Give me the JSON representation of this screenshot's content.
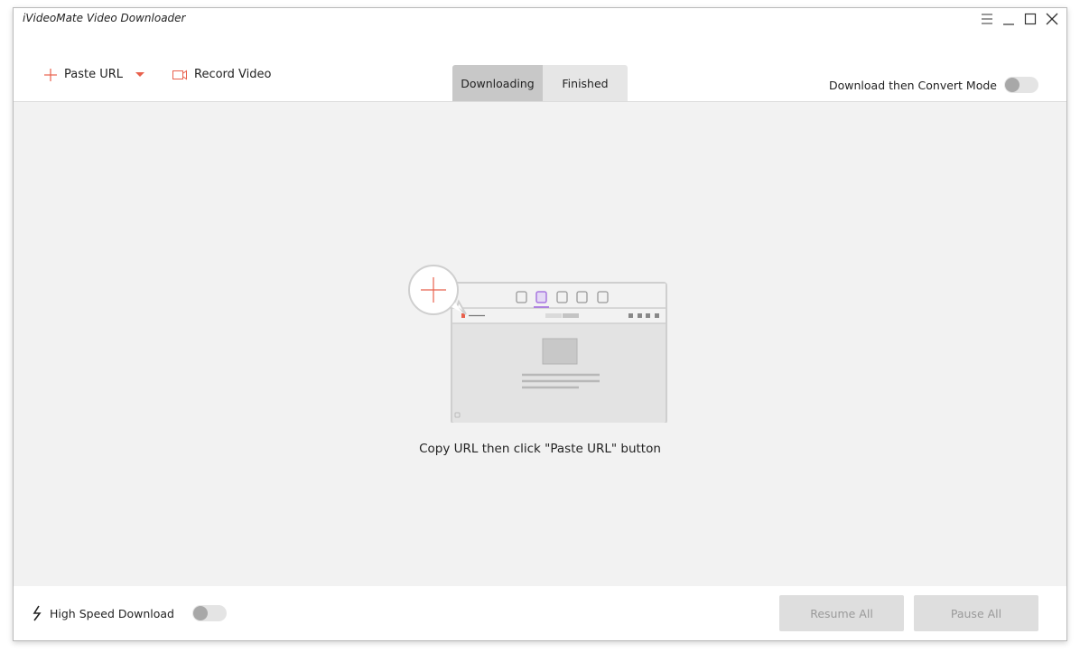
{
  "window": {
    "title": "iVideoMate Video Downloader"
  },
  "toolbar": {
    "paste_url_label": "Paste URL",
    "record_video_label": "Record Video",
    "accent_color": "#e8604c"
  },
  "tabs": [
    {
      "label": "Downloading",
      "active": true
    },
    {
      "label": "Finished",
      "active": false
    }
  ],
  "convert_mode": {
    "label": "Download then Convert Mode",
    "enabled": false
  },
  "main": {
    "empty_hint": "Copy URL then click \"Paste URL\" button",
    "illustration_highlight_color": "#a877e0"
  },
  "footer": {
    "high_speed_label": "High Speed Download",
    "high_speed_enabled": false,
    "resume_all_label": "Resume All",
    "pause_all_label": "Pause All"
  }
}
